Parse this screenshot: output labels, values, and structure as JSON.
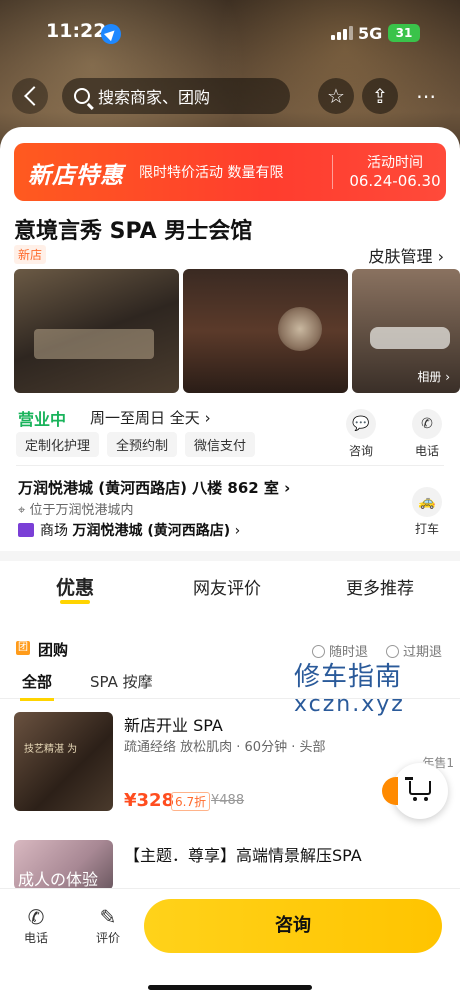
{
  "status_bar": {
    "time": "11:22",
    "network": "5G",
    "battery": "31"
  },
  "nav": {
    "search_placeholder": "搜索商家、团购",
    "star_icon": "star-icon",
    "share_icon": "share-icon",
    "more_icon": "more-icon"
  },
  "promo": {
    "title": "新店特惠",
    "subtitle": "限时特价活动 数量有限",
    "time_label": "活动时间",
    "time_value": "06.24-06.30",
    "color": "#ff4a2a"
  },
  "shop": {
    "name": "意境言秀 SPA 男士会馆",
    "badge": "新店",
    "category_link": "皮肤管理",
    "album_label": "相册",
    "open_status": "营业中",
    "hours": "周一至周日 全天",
    "tags": [
      "定制化护理",
      "全预约制",
      "微信支付"
    ],
    "consult_label": "咨询",
    "phone_label": "电话",
    "address": "万润悦港城 (黄河西路店) 八楼 862 室",
    "location_note": "位于万润悦港城内",
    "mall_prefix": "商场",
    "mall_name": "万润悦港城 (黄河西路店)",
    "taxi_label": "打车"
  },
  "tabs": [
    "优惠",
    "网友评价",
    "更多推荐"
  ],
  "deals_section": {
    "label": "团购",
    "guarantee1": "随时退",
    "guarantee2": "过期退",
    "subtabs": [
      "全部",
      "SPA 按摩"
    ]
  },
  "watermark": {
    "line1": "修车指南",
    "line2": "xczn.xyz"
  },
  "deals": [
    {
      "title": "新店开业 SPA",
      "desc": "疏通经络 放松肌肉 · 60分钟 · 头部",
      "price": "¥328",
      "discount": "6.7折",
      "original": "¥488",
      "sold": "年售1",
      "thumb_text": "技艺精湛 为"
    },
    {
      "title": "【主题．尊享】高端情景解压SPA",
      "thumb_text": "成人の体验"
    }
  ],
  "bottom_bar": {
    "phone": "电话",
    "review": "评价",
    "consult": "咨询"
  },
  "colors": {
    "accent": "#ffd400",
    "price": "#ff4d1f",
    "open": "#19b35b"
  }
}
